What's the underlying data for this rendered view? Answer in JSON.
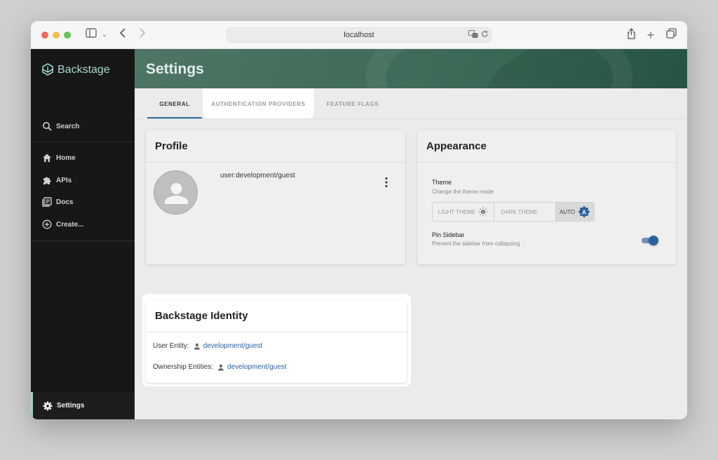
{
  "browser": {
    "url": "localhost"
  },
  "sidebar": {
    "logo": "Backstage",
    "search": "Search",
    "items": [
      {
        "label": "Home"
      },
      {
        "label": "APIs"
      },
      {
        "label": "Docs"
      },
      {
        "label": "Create..."
      }
    ],
    "settings": "Settings"
  },
  "header": {
    "title": "Settings"
  },
  "tabs": [
    {
      "label": "GENERAL",
      "active": true
    },
    {
      "label": "AUTHENTICATION PROVIDERS",
      "active": false
    },
    {
      "label": "FEATURE FLAGS",
      "active": false
    }
  ],
  "profile": {
    "title": "Profile",
    "user": "user:development/guest"
  },
  "appearance": {
    "title": "Appearance",
    "theme_label": "Theme",
    "theme_sub": "Change the theme mode",
    "theme_options": [
      {
        "label": "LIGHT THEME",
        "icon": "sun-icon"
      },
      {
        "label": "DARK THEME",
        "icon": "moon-icon"
      },
      {
        "label": "AUTO",
        "icon": "auto-theme-icon",
        "selected": true
      }
    ],
    "pin_label": "Pin Sidebar",
    "pin_sub": "Prevent the sidebar from collapsing",
    "pin_enabled": true
  },
  "identity": {
    "title": "Backstage Identity",
    "user_entity_label": "User Entity:",
    "user_entity_value": "development/guest",
    "ownership_label": "Ownership Entities:",
    "ownership_value": "development/guest"
  },
  "colors": {
    "accent": "#2e6d9c",
    "sidebar_bg": "#171717",
    "banner": "#3d6b58",
    "link": "#2b5fa3"
  }
}
